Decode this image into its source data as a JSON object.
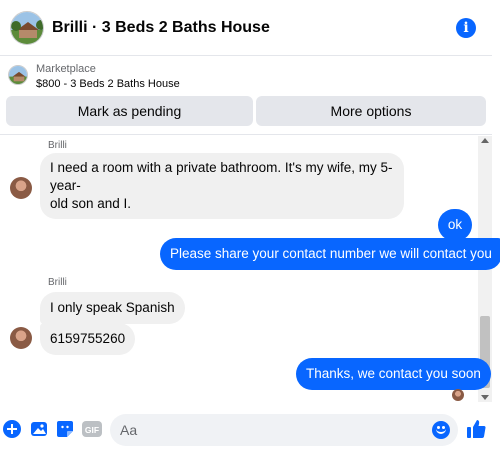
{
  "header": {
    "title": "Brilli · 3 Beds 2 Baths House",
    "info_icon": "info-icon"
  },
  "marketplace": {
    "label": "Marketplace",
    "listing": "$800 - 3 Beds 2 Baths House",
    "mark_pending": "Mark as pending",
    "more_options": "More options"
  },
  "messages": [
    {
      "sender": "Brilli",
      "line1": "I need a room with a private bathroom. It's my wife, my 5-year-",
      "line2": "old son and I."
    },
    {
      "text": "ok"
    },
    {
      "text": "Please share your contact number we will contact you"
    },
    {
      "sender": "Brilli",
      "text": "I only speak Spanish"
    },
    {
      "text": "6159755260"
    },
    {
      "text": "Thanks, we contact you soon"
    }
  ],
  "composer": {
    "placeholder": "Aa"
  },
  "colors": {
    "accent": "#0866ff",
    "incoming": "#f0f0f0"
  },
  "icons": [
    "plus-icon",
    "image-icon",
    "sticker-icon",
    "gif-icon",
    "emoji-icon",
    "like-icon"
  ]
}
